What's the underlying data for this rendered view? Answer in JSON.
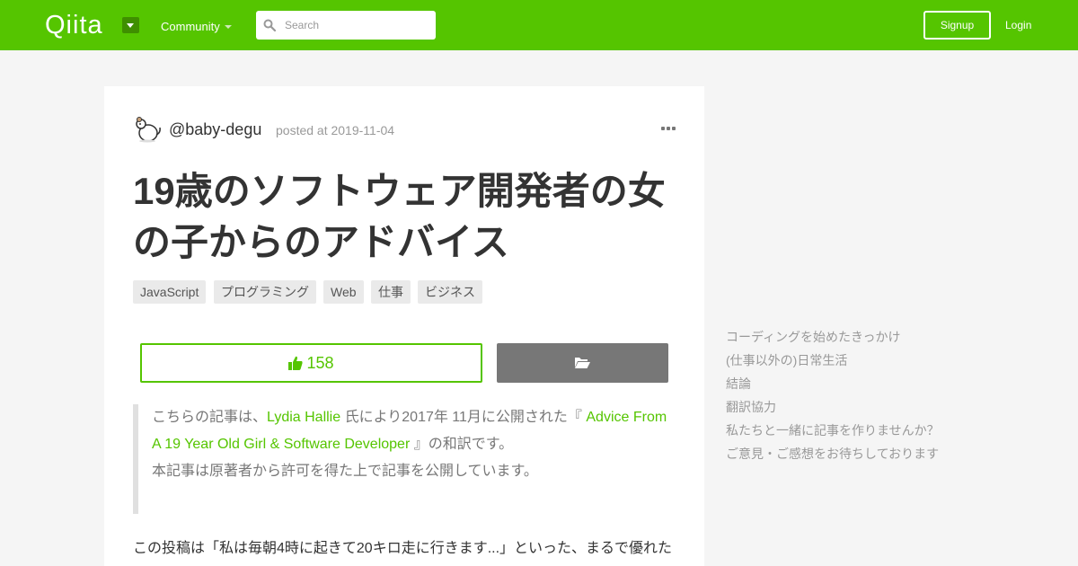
{
  "header": {
    "logo": "Qiita",
    "community_label": "Community",
    "search_placeholder": "Search",
    "signup_label": "Signup",
    "login_label": "Login",
    "brand_color": "#55c500"
  },
  "article": {
    "username": "@baby-degu",
    "posted": "posted at 2019-11-04",
    "title_line1": "19歳のソフトウェア開発者の女",
    "title_line2": "の子からのアドバイス",
    "tags": [
      "JavaScript",
      "プログラミング",
      "Web",
      "仕事",
      "ビジネス"
    ],
    "likes": "158",
    "quote": {
      "pre": "こちらの記事は、",
      "author": "Lydia Hallie",
      "mid": " 氏により2017年 11月に公開された『 ",
      "original_title": "Advice From A 19 Year Old Girl & Software Developer",
      "post": " 』の和訳です。",
      "line2": "本記事は原著者から許可を得た上で記事を公開しています。"
    },
    "body_first_line": "この投稿は「私は毎朝4時に起きて20キロ走に行きます...」といった、まるで優れた"
  },
  "toc": {
    "items": [
      "コーディングを始めたきっかけ",
      "(仕事以外の)日常生活",
      "結論",
      "翻訳協力",
      "私たちと一緒に記事を作りませんか？",
      "ご意見・ご感想をお待ちしております"
    ]
  }
}
